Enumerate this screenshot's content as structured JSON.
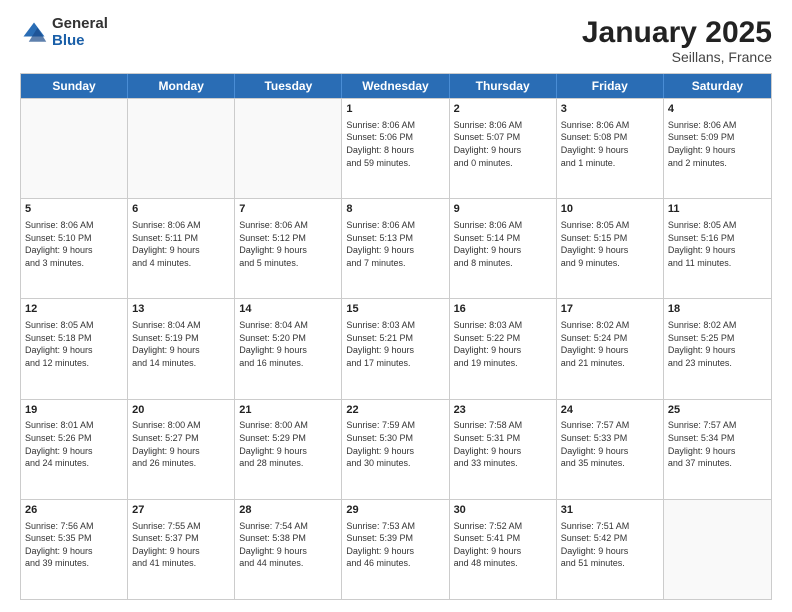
{
  "logo": {
    "general": "General",
    "blue": "Blue"
  },
  "header": {
    "month": "January 2025",
    "location": "Seillans, France"
  },
  "weekdays": [
    "Sunday",
    "Monday",
    "Tuesday",
    "Wednesday",
    "Thursday",
    "Friday",
    "Saturday"
  ],
  "weeks": [
    [
      {
        "day": "",
        "info": ""
      },
      {
        "day": "",
        "info": ""
      },
      {
        "day": "",
        "info": ""
      },
      {
        "day": "1",
        "info": "Sunrise: 8:06 AM\nSunset: 5:06 PM\nDaylight: 8 hours\nand 59 minutes."
      },
      {
        "day": "2",
        "info": "Sunrise: 8:06 AM\nSunset: 5:07 PM\nDaylight: 9 hours\nand 0 minutes."
      },
      {
        "day": "3",
        "info": "Sunrise: 8:06 AM\nSunset: 5:08 PM\nDaylight: 9 hours\nand 1 minute."
      },
      {
        "day": "4",
        "info": "Sunrise: 8:06 AM\nSunset: 5:09 PM\nDaylight: 9 hours\nand 2 minutes."
      }
    ],
    [
      {
        "day": "5",
        "info": "Sunrise: 8:06 AM\nSunset: 5:10 PM\nDaylight: 9 hours\nand 3 minutes."
      },
      {
        "day": "6",
        "info": "Sunrise: 8:06 AM\nSunset: 5:11 PM\nDaylight: 9 hours\nand 4 minutes."
      },
      {
        "day": "7",
        "info": "Sunrise: 8:06 AM\nSunset: 5:12 PM\nDaylight: 9 hours\nand 5 minutes."
      },
      {
        "day": "8",
        "info": "Sunrise: 8:06 AM\nSunset: 5:13 PM\nDaylight: 9 hours\nand 7 minutes."
      },
      {
        "day": "9",
        "info": "Sunrise: 8:06 AM\nSunset: 5:14 PM\nDaylight: 9 hours\nand 8 minutes."
      },
      {
        "day": "10",
        "info": "Sunrise: 8:05 AM\nSunset: 5:15 PM\nDaylight: 9 hours\nand 9 minutes."
      },
      {
        "day": "11",
        "info": "Sunrise: 8:05 AM\nSunset: 5:16 PM\nDaylight: 9 hours\nand 11 minutes."
      }
    ],
    [
      {
        "day": "12",
        "info": "Sunrise: 8:05 AM\nSunset: 5:18 PM\nDaylight: 9 hours\nand 12 minutes."
      },
      {
        "day": "13",
        "info": "Sunrise: 8:04 AM\nSunset: 5:19 PM\nDaylight: 9 hours\nand 14 minutes."
      },
      {
        "day": "14",
        "info": "Sunrise: 8:04 AM\nSunset: 5:20 PM\nDaylight: 9 hours\nand 16 minutes."
      },
      {
        "day": "15",
        "info": "Sunrise: 8:03 AM\nSunset: 5:21 PM\nDaylight: 9 hours\nand 17 minutes."
      },
      {
        "day": "16",
        "info": "Sunrise: 8:03 AM\nSunset: 5:22 PM\nDaylight: 9 hours\nand 19 minutes."
      },
      {
        "day": "17",
        "info": "Sunrise: 8:02 AM\nSunset: 5:24 PM\nDaylight: 9 hours\nand 21 minutes."
      },
      {
        "day": "18",
        "info": "Sunrise: 8:02 AM\nSunset: 5:25 PM\nDaylight: 9 hours\nand 23 minutes."
      }
    ],
    [
      {
        "day": "19",
        "info": "Sunrise: 8:01 AM\nSunset: 5:26 PM\nDaylight: 9 hours\nand 24 minutes."
      },
      {
        "day": "20",
        "info": "Sunrise: 8:00 AM\nSunset: 5:27 PM\nDaylight: 9 hours\nand 26 minutes."
      },
      {
        "day": "21",
        "info": "Sunrise: 8:00 AM\nSunset: 5:29 PM\nDaylight: 9 hours\nand 28 minutes."
      },
      {
        "day": "22",
        "info": "Sunrise: 7:59 AM\nSunset: 5:30 PM\nDaylight: 9 hours\nand 30 minutes."
      },
      {
        "day": "23",
        "info": "Sunrise: 7:58 AM\nSunset: 5:31 PM\nDaylight: 9 hours\nand 33 minutes."
      },
      {
        "day": "24",
        "info": "Sunrise: 7:57 AM\nSunset: 5:33 PM\nDaylight: 9 hours\nand 35 minutes."
      },
      {
        "day": "25",
        "info": "Sunrise: 7:57 AM\nSunset: 5:34 PM\nDaylight: 9 hours\nand 37 minutes."
      }
    ],
    [
      {
        "day": "26",
        "info": "Sunrise: 7:56 AM\nSunset: 5:35 PM\nDaylight: 9 hours\nand 39 minutes."
      },
      {
        "day": "27",
        "info": "Sunrise: 7:55 AM\nSunset: 5:37 PM\nDaylight: 9 hours\nand 41 minutes."
      },
      {
        "day": "28",
        "info": "Sunrise: 7:54 AM\nSunset: 5:38 PM\nDaylight: 9 hours\nand 44 minutes."
      },
      {
        "day": "29",
        "info": "Sunrise: 7:53 AM\nSunset: 5:39 PM\nDaylight: 9 hours\nand 46 minutes."
      },
      {
        "day": "30",
        "info": "Sunrise: 7:52 AM\nSunset: 5:41 PM\nDaylight: 9 hours\nand 48 minutes."
      },
      {
        "day": "31",
        "info": "Sunrise: 7:51 AM\nSunset: 5:42 PM\nDaylight: 9 hours\nand 51 minutes."
      },
      {
        "day": "",
        "info": ""
      }
    ]
  ]
}
